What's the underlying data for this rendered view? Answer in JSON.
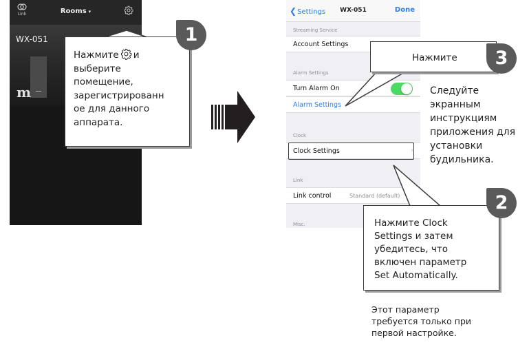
{
  "left_phone": {
    "link_label": "Link",
    "rooms_title": "Rooms",
    "rooms_caret": "▾",
    "room_name": "WX-051",
    "brand_logo": "m",
    "icons": {
      "link": "link-icon",
      "settings": "gear-icon"
    }
  },
  "callout1": {
    "badge": "1",
    "text_before_icon": "Нажмите",
    "text_after_icon": "и",
    "text_lines": [
      "выберите",
      "помещение,",
      "зарегистрированн",
      "ое для данного",
      "аппарата."
    ]
  },
  "right_phone": {
    "nav": {
      "back": "Settings",
      "title": "WX-051",
      "done": "Done"
    },
    "sections": {
      "streaming": "Streaming Service",
      "alarm": "Alarm Settings",
      "clock": "Clock",
      "link": "Link",
      "misc": "Misc."
    },
    "rows": {
      "account_settings": "Account Settings",
      "turn_alarm_on": "Turn Alarm On",
      "alarm_settings": "Alarm Settings",
      "clock_settings": "Clock Settings",
      "link_control": "Link control",
      "link_control_value": "Standard (default)"
    },
    "alarm_toggle_on": true,
    "accent_color": "#2b7de9",
    "toggle_color": "#4cd964"
  },
  "callout3": {
    "badge": "3",
    "text": "Нажмите"
  },
  "callout2": {
    "badge": "2",
    "text_lines": [
      "Нажмите Clock",
      "Settings и затем",
      "убедитесь, что",
      "включен параметр",
      "Set Automatically."
    ]
  },
  "side_text_lines": [
    "Следуйте",
    "экранным",
    "инструкциям",
    "приложения для",
    "установки",
    "будильника."
  ],
  "note_lines": [
    "Этот параметр",
    "требуется только при",
    "первой настройке."
  ]
}
